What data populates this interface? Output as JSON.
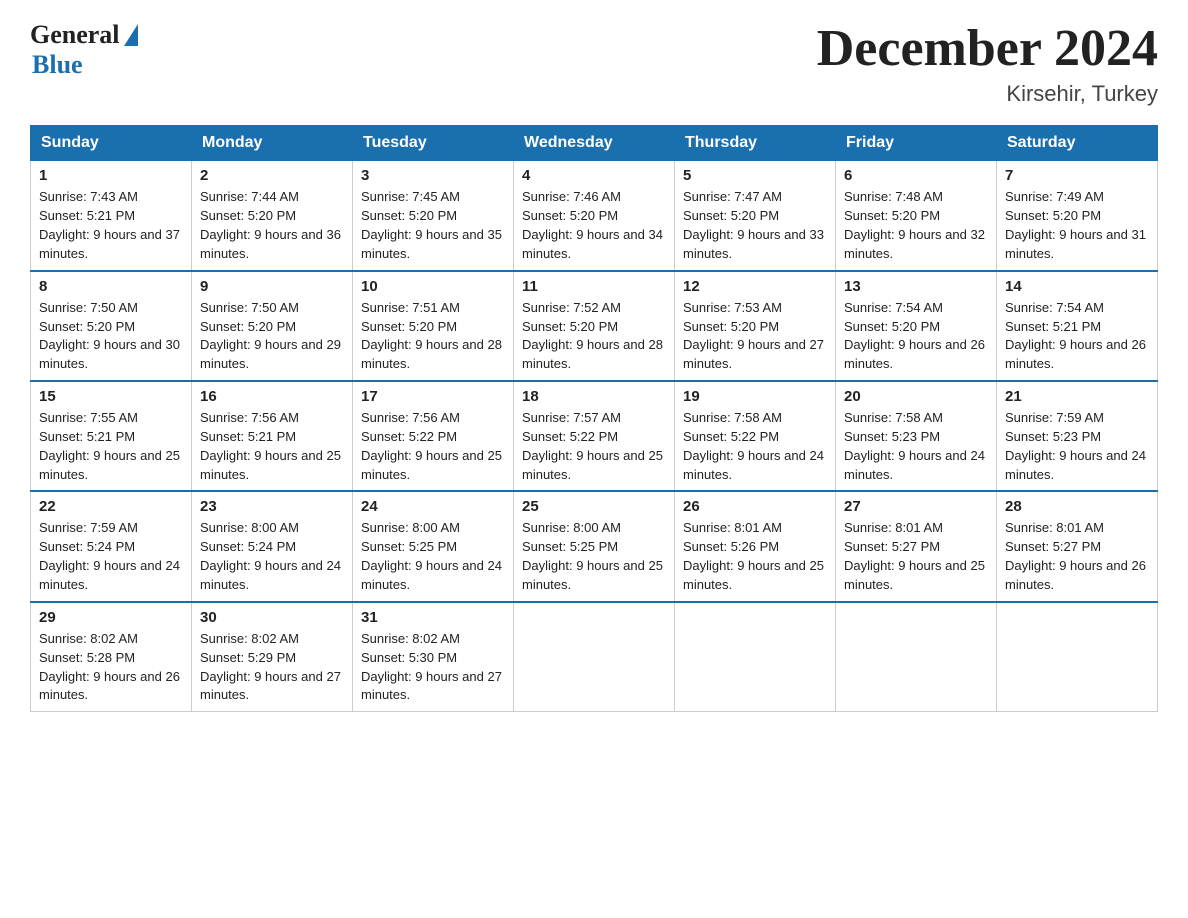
{
  "header": {
    "logo_general": "General",
    "logo_blue": "Blue",
    "month_title": "December 2024",
    "location": "Kirsehir, Turkey"
  },
  "days_of_week": [
    "Sunday",
    "Monday",
    "Tuesday",
    "Wednesday",
    "Thursday",
    "Friday",
    "Saturday"
  ],
  "weeks": [
    [
      {
        "day": "1",
        "sunrise": "7:43 AM",
        "sunset": "5:21 PM",
        "daylight": "9 hours and 37 minutes."
      },
      {
        "day": "2",
        "sunrise": "7:44 AM",
        "sunset": "5:20 PM",
        "daylight": "9 hours and 36 minutes."
      },
      {
        "day": "3",
        "sunrise": "7:45 AM",
        "sunset": "5:20 PM",
        "daylight": "9 hours and 35 minutes."
      },
      {
        "day": "4",
        "sunrise": "7:46 AM",
        "sunset": "5:20 PM",
        "daylight": "9 hours and 34 minutes."
      },
      {
        "day": "5",
        "sunrise": "7:47 AM",
        "sunset": "5:20 PM",
        "daylight": "9 hours and 33 minutes."
      },
      {
        "day": "6",
        "sunrise": "7:48 AM",
        "sunset": "5:20 PM",
        "daylight": "9 hours and 32 minutes."
      },
      {
        "day": "7",
        "sunrise": "7:49 AM",
        "sunset": "5:20 PM",
        "daylight": "9 hours and 31 minutes."
      }
    ],
    [
      {
        "day": "8",
        "sunrise": "7:50 AM",
        "sunset": "5:20 PM",
        "daylight": "9 hours and 30 minutes."
      },
      {
        "day": "9",
        "sunrise": "7:50 AM",
        "sunset": "5:20 PM",
        "daylight": "9 hours and 29 minutes."
      },
      {
        "day": "10",
        "sunrise": "7:51 AM",
        "sunset": "5:20 PM",
        "daylight": "9 hours and 28 minutes."
      },
      {
        "day": "11",
        "sunrise": "7:52 AM",
        "sunset": "5:20 PM",
        "daylight": "9 hours and 28 minutes."
      },
      {
        "day": "12",
        "sunrise": "7:53 AM",
        "sunset": "5:20 PM",
        "daylight": "9 hours and 27 minutes."
      },
      {
        "day": "13",
        "sunrise": "7:54 AM",
        "sunset": "5:20 PM",
        "daylight": "9 hours and 26 minutes."
      },
      {
        "day": "14",
        "sunrise": "7:54 AM",
        "sunset": "5:21 PM",
        "daylight": "9 hours and 26 minutes."
      }
    ],
    [
      {
        "day": "15",
        "sunrise": "7:55 AM",
        "sunset": "5:21 PM",
        "daylight": "9 hours and 25 minutes."
      },
      {
        "day": "16",
        "sunrise": "7:56 AM",
        "sunset": "5:21 PM",
        "daylight": "9 hours and 25 minutes."
      },
      {
        "day": "17",
        "sunrise": "7:56 AM",
        "sunset": "5:22 PM",
        "daylight": "9 hours and 25 minutes."
      },
      {
        "day": "18",
        "sunrise": "7:57 AM",
        "sunset": "5:22 PM",
        "daylight": "9 hours and 25 minutes."
      },
      {
        "day": "19",
        "sunrise": "7:58 AM",
        "sunset": "5:22 PM",
        "daylight": "9 hours and 24 minutes."
      },
      {
        "day": "20",
        "sunrise": "7:58 AM",
        "sunset": "5:23 PM",
        "daylight": "9 hours and 24 minutes."
      },
      {
        "day": "21",
        "sunrise": "7:59 AM",
        "sunset": "5:23 PM",
        "daylight": "9 hours and 24 minutes."
      }
    ],
    [
      {
        "day": "22",
        "sunrise": "7:59 AM",
        "sunset": "5:24 PM",
        "daylight": "9 hours and 24 minutes."
      },
      {
        "day": "23",
        "sunrise": "8:00 AM",
        "sunset": "5:24 PM",
        "daylight": "9 hours and 24 minutes."
      },
      {
        "day": "24",
        "sunrise": "8:00 AM",
        "sunset": "5:25 PM",
        "daylight": "9 hours and 24 minutes."
      },
      {
        "day": "25",
        "sunrise": "8:00 AM",
        "sunset": "5:25 PM",
        "daylight": "9 hours and 25 minutes."
      },
      {
        "day": "26",
        "sunrise": "8:01 AM",
        "sunset": "5:26 PM",
        "daylight": "9 hours and 25 minutes."
      },
      {
        "day": "27",
        "sunrise": "8:01 AM",
        "sunset": "5:27 PM",
        "daylight": "9 hours and 25 minutes."
      },
      {
        "day": "28",
        "sunrise": "8:01 AM",
        "sunset": "5:27 PM",
        "daylight": "9 hours and 26 minutes."
      }
    ],
    [
      {
        "day": "29",
        "sunrise": "8:02 AM",
        "sunset": "5:28 PM",
        "daylight": "9 hours and 26 minutes."
      },
      {
        "day": "30",
        "sunrise": "8:02 AM",
        "sunset": "5:29 PM",
        "daylight": "9 hours and 27 minutes."
      },
      {
        "day": "31",
        "sunrise": "8:02 AM",
        "sunset": "5:30 PM",
        "daylight": "9 hours and 27 minutes."
      },
      null,
      null,
      null,
      null
    ]
  ]
}
